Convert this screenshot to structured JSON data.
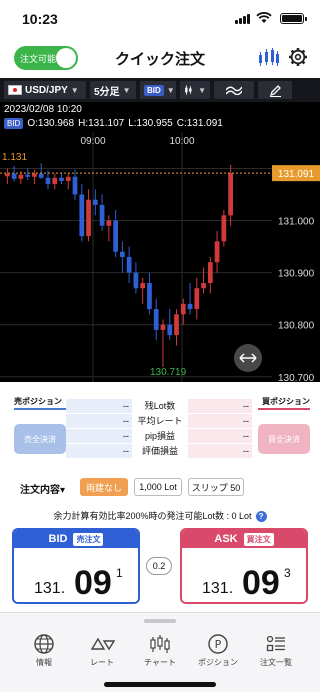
{
  "status": {
    "time": "10:23"
  },
  "header": {
    "toggle_label": "注文可能",
    "title": "クイック注文"
  },
  "chart_toolbar": {
    "pair": "USD/JPY",
    "timeframe": "5分足",
    "price_type": "BID"
  },
  "chart_info": {
    "datetime": "2023/02/08 10:20",
    "badge": "BID",
    "open": "O:130.968",
    "high": "H:131.107",
    "low": "L:130.955",
    "close": "C:131.091"
  },
  "chart_data": {
    "type": "candlestick",
    "x_labels": [
      "09:00",
      "10:00"
    ],
    "y_ticks": [
      "131.100",
      "131.000",
      "130.900",
      "130.800",
      "130.700"
    ],
    "ylim": [
      130.69,
      131.17
    ],
    "current_price": "131.091",
    "high_label": "1.131",
    "low_label": "130.719",
    "candles": [
      {
        "o": 131.085,
        "h": 131.1,
        "l": 131.07,
        "c": 131.09
      },
      {
        "o": 131.09,
        "h": 131.105,
        "l": 131.075,
        "c": 131.08
      },
      {
        "o": 131.08,
        "h": 131.095,
        "l": 131.07,
        "c": 131.088
      },
      {
        "o": 131.088,
        "h": 131.1,
        "l": 131.078,
        "c": 131.084
      },
      {
        "o": 131.084,
        "h": 131.098,
        "l": 131.07,
        "c": 131.09
      },
      {
        "o": 131.09,
        "h": 131.11,
        "l": 131.08,
        "c": 131.082
      },
      {
        "o": 131.082,
        "h": 131.096,
        "l": 131.06,
        "c": 131.07
      },
      {
        "o": 131.07,
        "h": 131.09,
        "l": 131.06,
        "c": 131.082
      },
      {
        "o": 131.082,
        "h": 131.092,
        "l": 131.07,
        "c": 131.076
      },
      {
        "o": 131.076,
        "h": 131.09,
        "l": 131.06,
        "c": 131.084
      },
      {
        "o": 131.084,
        "h": 131.098,
        "l": 131.04,
        "c": 131.05
      },
      {
        "o": 131.05,
        "h": 131.07,
        "l": 130.96,
        "c": 130.97
      },
      {
        "o": 130.97,
        "h": 131.06,
        "l": 130.96,
        "c": 131.04
      },
      {
        "o": 131.04,
        "h": 131.06,
        "l": 131.01,
        "c": 131.03
      },
      {
        "o": 131.03,
        "h": 131.05,
        "l": 130.98,
        "c": 130.99
      },
      {
        "o": 130.99,
        "h": 131.01,
        "l": 130.96,
        "c": 131.0
      },
      {
        "o": 131.0,
        "h": 131.02,
        "l": 130.93,
        "c": 130.94
      },
      {
        "o": 130.94,
        "h": 130.96,
        "l": 130.9,
        "c": 130.93
      },
      {
        "o": 130.93,
        "h": 130.95,
        "l": 130.88,
        "c": 130.9
      },
      {
        "o": 130.9,
        "h": 130.92,
        "l": 130.86,
        "c": 130.87
      },
      {
        "o": 130.87,
        "h": 130.89,
        "l": 130.84,
        "c": 130.88
      },
      {
        "o": 130.88,
        "h": 130.9,
        "l": 130.82,
        "c": 130.83
      },
      {
        "o": 130.83,
        "h": 130.85,
        "l": 130.77,
        "c": 130.79
      },
      {
        "o": 130.79,
        "h": 130.81,
        "l": 130.719,
        "c": 130.8
      },
      {
        "o": 130.8,
        "h": 130.83,
        "l": 130.77,
        "c": 130.78
      },
      {
        "o": 130.78,
        "h": 130.83,
        "l": 130.76,
        "c": 130.82
      },
      {
        "o": 130.82,
        "h": 130.85,
        "l": 130.8,
        "c": 130.84
      },
      {
        "o": 130.84,
        "h": 130.88,
        "l": 130.82,
        "c": 130.83
      },
      {
        "o": 130.83,
        "h": 130.89,
        "l": 130.81,
        "c": 130.87
      },
      {
        "o": 130.87,
        "h": 130.91,
        "l": 130.86,
        "c": 130.88
      },
      {
        "o": 130.88,
        "h": 130.93,
        "l": 130.86,
        "c": 130.92
      },
      {
        "o": 130.92,
        "h": 130.98,
        "l": 130.9,
        "c": 130.96
      },
      {
        "o": 130.96,
        "h": 131.02,
        "l": 130.95,
        "c": 131.01
      },
      {
        "o": 131.01,
        "h": 131.107,
        "l": 130.99,
        "c": 131.091
      }
    ]
  },
  "position": {
    "sell_header": "売ポジション",
    "buy_header": "買ポジション",
    "sell_close": "売全決済",
    "buy_close": "買全決済",
    "rows": [
      {
        "label": "残Lot数",
        "sell": "--",
        "buy": "--"
      },
      {
        "label": "平均レート",
        "sell": "--",
        "buy": "--"
      },
      {
        "label": "pip損益",
        "sell": "--",
        "buy": "--"
      },
      {
        "label": "評価損益",
        "sell": "--",
        "buy": "--"
      }
    ]
  },
  "order": {
    "label": "注文内容",
    "caret": "▾",
    "expiry": "両建なし",
    "lot": "1,000 Lot",
    "slippage": "スリップ 50",
    "note": "余力計算有効比率200%時の発注可能Lot数 : 0 Lot",
    "help": "?"
  },
  "quotes": {
    "bid": {
      "label": "BID",
      "tag": "売注文",
      "prefix": "131.",
      "big": "09",
      "sup": "1"
    },
    "ask": {
      "label": "ASK",
      "tag": "買注文",
      "prefix": "131.",
      "big": "09",
      "sup": "3"
    },
    "spread": "0.2"
  },
  "colors": {
    "bid": "#2f5fd4",
    "ask": "#d94a6a",
    "accent_green": "#3bb54a",
    "price_line": "#e89a2c"
  },
  "tabs": [
    {
      "label": "情報",
      "icon": "globe-icon"
    },
    {
      "label": "レート",
      "icon": "rate-icon"
    },
    {
      "label": "チャート",
      "icon": "chart-icon"
    },
    {
      "label": "ポジション",
      "icon": "position-icon"
    },
    {
      "label": "注文一覧",
      "icon": "list-icon"
    }
  ]
}
